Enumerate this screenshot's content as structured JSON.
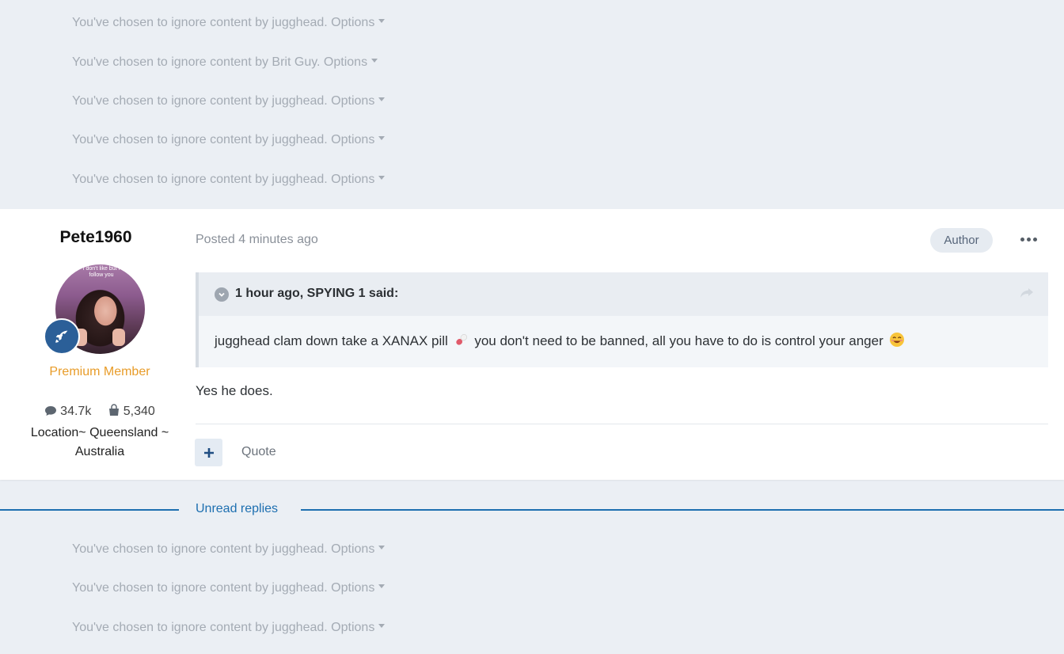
{
  "ignored_top": [
    {
      "text": "You've chosen to ignore content by jugghead.",
      "options": "Options"
    },
    {
      "text": "You've chosen to ignore content by Brit Guy.",
      "options": "Options"
    },
    {
      "text": "You've chosen to ignore content by jugghead.",
      "options": "Options"
    },
    {
      "text": "You've chosen to ignore content by jugghead.",
      "options": "Options"
    },
    {
      "text": "You've chosen to ignore content by jugghead.",
      "options": "Options"
    }
  ],
  "post": {
    "author": "Pete1960",
    "avatar_text": "I don't like but I follow you",
    "member_title": "Premium Member",
    "stats": {
      "posts": "34.7k",
      "items": "5,340"
    },
    "location": "Location~ Queensland ~ Australia",
    "posted": "Posted 4 minutes ago",
    "author_badge": "Author",
    "quote": {
      "citation": "1 hour ago, SPYING 1 said:",
      "text_before_emoji": "jugghead clam down take a XANAX pill",
      "text_after_emoji": "you don't need to be banned, all you have to do is control your anger"
    },
    "body": "Yes he does.",
    "react_label": "+",
    "quote_link": "Quote"
  },
  "divider": {
    "label": "Unread replies"
  },
  "ignored_bottom": [
    {
      "text": "You've chosen to ignore content by jugghead.",
      "options": "Options"
    },
    {
      "text": "You've chosen to ignore content by jugghead.",
      "options": "Options"
    },
    {
      "text": "You've chosen to ignore content by jugghead.",
      "options": "Options"
    }
  ],
  "icons": [
    "caret-down-icon",
    "rocket-icon",
    "comment-icon",
    "shopping-bag-icon",
    "ellipsis-icon",
    "chevron-circle-icon",
    "share-icon",
    "pill-emoji",
    "smiling-emoji",
    "plus-icon"
  ],
  "colors": {
    "page_bg": "#ebeff4",
    "accent": "#1d6fb0",
    "member_title": "#e89c29",
    "badge_bg": "#2b5f98"
  }
}
